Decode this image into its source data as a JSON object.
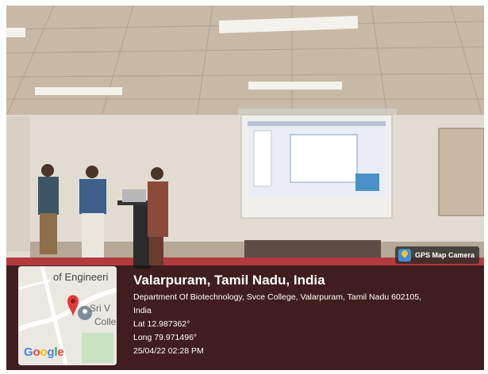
{
  "badge": {
    "label": "GPS Map Camera",
    "icon": "map-pin-icon"
  },
  "map": {
    "label_college_top": "of Engineeri",
    "label_college_mid": "Sri V",
    "label_college_low": "Colle",
    "logo_letters": [
      "G",
      "o",
      "o",
      "g",
      "l",
      "e"
    ],
    "pin_color": "#e53935"
  },
  "location": {
    "place": "Valarpuram, Tamil Nadu, India",
    "address_line1": "Department Of Biotechnology, Svce College, Valarpuram, Tamil Nadu 602105,",
    "address_line2": "India",
    "latitude": "Lat 12.987362°",
    "longitude": "Long 79.971496°",
    "datetime": "25/04/22 02:28 PM"
  }
}
